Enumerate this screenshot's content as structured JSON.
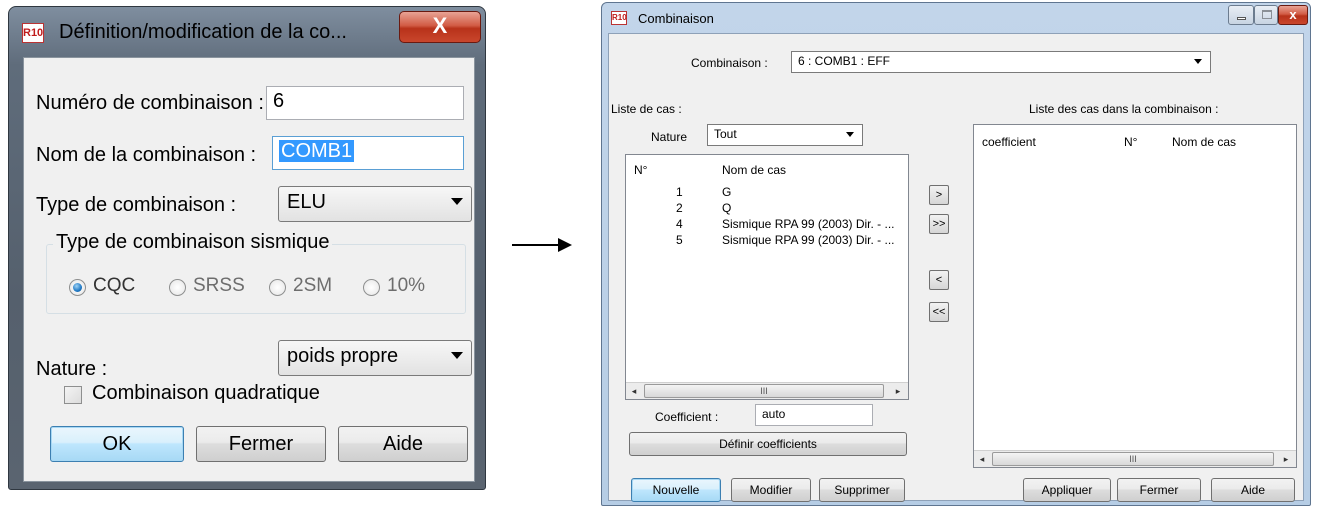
{
  "dialog1": {
    "title": "Définition/modification de la co...",
    "app_icon_text": "R10",
    "close_glyph": "X",
    "numero_label": "Numéro de combinaison :",
    "numero_value": "6",
    "nom_label": "Nom de la combinaison :",
    "nom_value": "COMB1",
    "type_label": "Type de combinaison :",
    "type_value": "ELU",
    "sismique_group": "Type de combinaison sismique",
    "radios": [
      "CQC",
      "SRSS",
      "2SM",
      "10%"
    ],
    "radio_selected": "CQC",
    "nature_label": "Nature :",
    "nature_value": "poids propre",
    "quadratique_label": "Combinaison quadratique",
    "buttons": {
      "ok": "OK",
      "fermer": "Fermer",
      "aide": "Aide"
    }
  },
  "dialog2": {
    "title": "Combinaison",
    "app_icon_text": "R10",
    "close_glyph": "x",
    "combinaison_label": "Combinaison :",
    "combinaison_value": "6 : COMB1 : EFF",
    "liste_cas_label": "Liste de cas :",
    "liste_combinaison_label": "Liste des cas dans la combinaison :",
    "nature_label": "Nature",
    "nature_value": "Tout",
    "left_list": {
      "headers": [
        "N°",
        "Nom de cas"
      ],
      "rows": [
        {
          "n": "1",
          "nom": "G"
        },
        {
          "n": "2",
          "nom": "Q"
        },
        {
          "n": "4",
          "nom": "Sismique RPA 99 (2003) Dir. - ..."
        },
        {
          "n": "5",
          "nom": "Sismique RPA 99 (2003) Dir. - ..."
        }
      ]
    },
    "right_list": {
      "headers": [
        "coefficient",
        "N°",
        "Nom de cas"
      ]
    },
    "transfer_buttons": [
      ">",
      ">>",
      "<",
      "<<"
    ],
    "scroll_glyphs": {
      "left": "◂",
      "right": "▸",
      "thumb": "III"
    },
    "coefficient_label": "Coefficient :",
    "coefficient_value": "auto",
    "definir_button": "Définir coefficients",
    "bottom_buttons": {
      "nouvelle": "Nouvelle",
      "modifier": "Modifier",
      "supprimer": "Supprimer",
      "appliquer": "Appliquer",
      "fermer": "Fermer",
      "aide": "Aide"
    }
  }
}
